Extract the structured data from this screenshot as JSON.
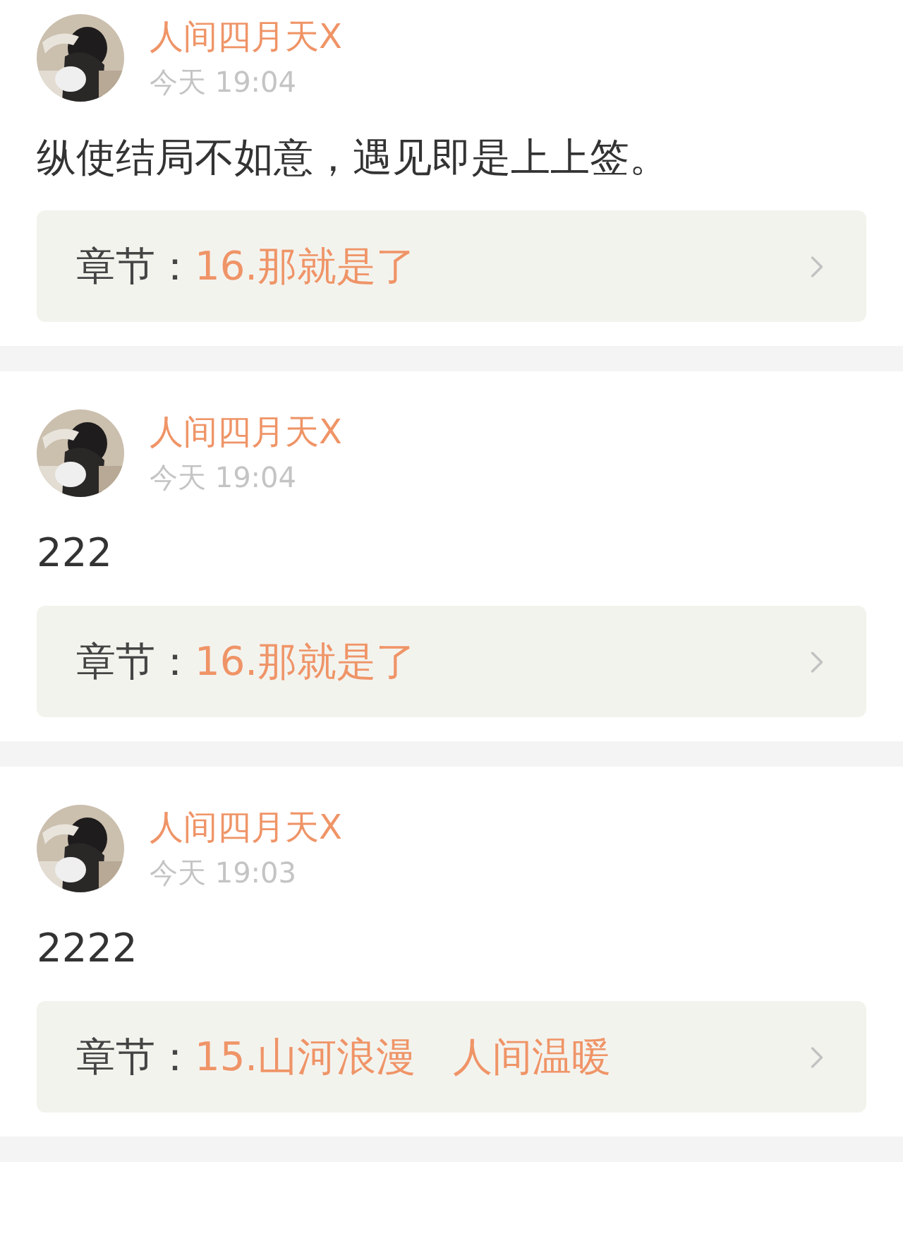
{
  "comments": [
    {
      "author": "人间四月天X",
      "time": "今天 19:04",
      "text": "纵使结局不如意，遇见即是上上签。",
      "chapter": {
        "label": "章节：",
        "title": "16.那就是了"
      }
    },
    {
      "author": "人间四月天X",
      "time": "今天 19:04",
      "text": "222",
      "chapter": {
        "label": "章节：",
        "title": "16.那就是了"
      }
    },
    {
      "author": "人间四月天X",
      "time": "今天 19:03",
      "text": "2222",
      "chapter": {
        "label": "章节：",
        "title": "15.山河浪漫   人间温暖"
      }
    }
  ]
}
